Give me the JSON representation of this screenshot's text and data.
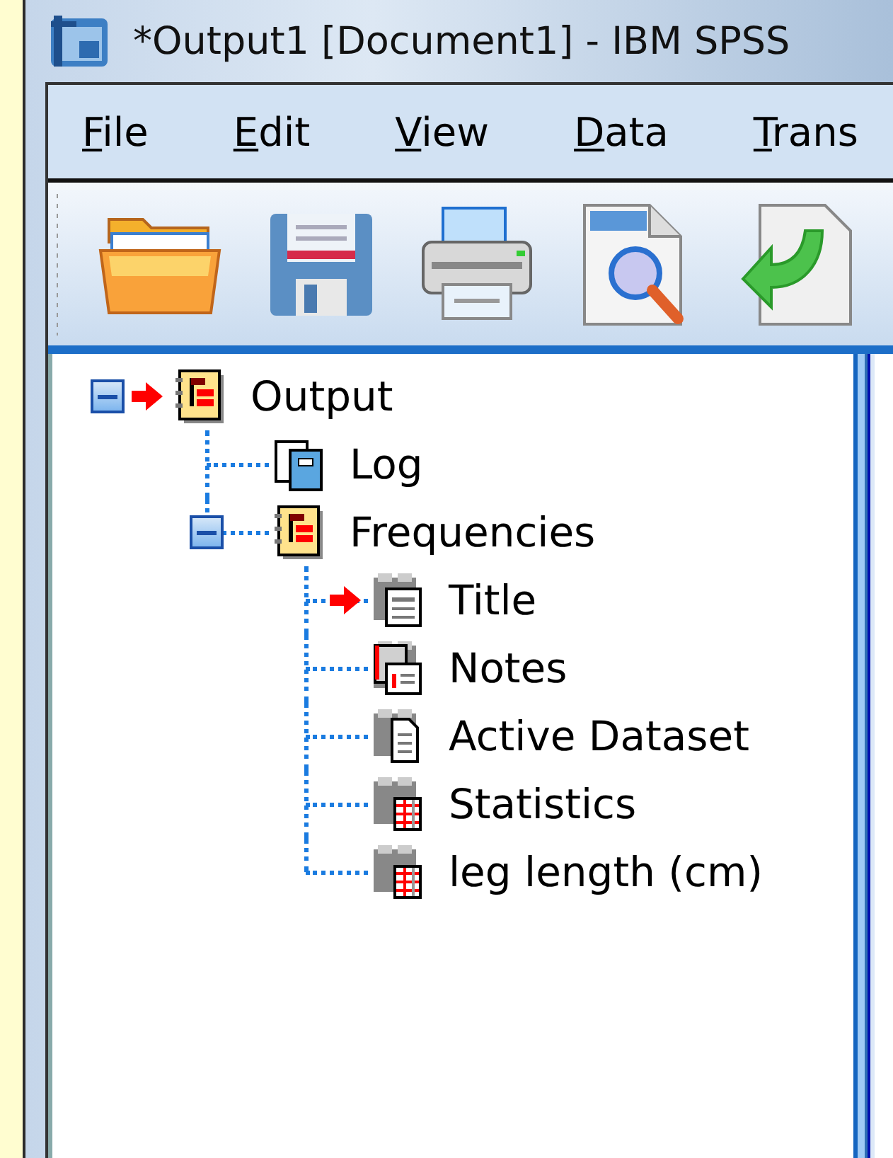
{
  "window": {
    "title": "*Output1 [Document1] - IBM SPSS"
  },
  "menu": [
    {
      "label": "File"
    },
    {
      "label": "Edit"
    },
    {
      "label": "View"
    },
    {
      "label": "Data"
    },
    {
      "label": "Trans"
    }
  ],
  "outline": [
    {
      "label": "Output",
      "kind": "heading",
      "expanded": true,
      "current": true,
      "children": [
        {
          "label": "Log",
          "kind": "log",
          "current": false
        },
        {
          "label": "Frequencies",
          "kind": "heading",
          "expanded": true,
          "current": false,
          "children": [
            {
              "label": "Title",
              "kind": "title",
              "current": true
            },
            {
              "label": "Notes",
              "kind": "notes",
              "current": false
            },
            {
              "label": "Active Dataset",
              "kind": "text",
              "current": false
            },
            {
              "label": "Statistics",
              "kind": "table",
              "current": false
            },
            {
              "label": "leg length (cm)",
              "kind": "table",
              "current": false
            }
          ]
        }
      ]
    }
  ]
}
